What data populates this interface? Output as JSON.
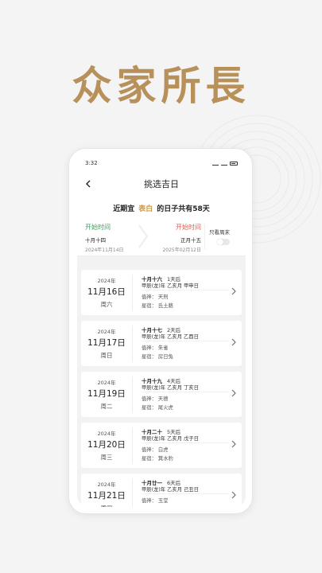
{
  "headline": "众家所長",
  "status": {
    "time": "3:32"
  },
  "nav": {
    "title": "挑选吉日"
  },
  "summary": {
    "prefix": "近期宜",
    "highlight": "表白",
    "suffix": "的日子共有58天"
  },
  "range": {
    "start_label": "开始时间",
    "start_lunar": "十月十四",
    "start_date": "2024年11月14日",
    "end_label": "开始时间",
    "end_lunar": "正月十五",
    "end_date": "2025年02月12日",
    "weekend_label": "只看周末",
    "weekend_only": false
  },
  "days": [
    {
      "year": "2024年",
      "day": "11月16日",
      "weekday": "周六",
      "lunar": "十月十六",
      "after": "1天后",
      "ganzhi": "甲辰(龙)年  乙亥月  甲申日",
      "deity": "值神：  天刑",
      "star": "星宿：  氐土貉"
    },
    {
      "year": "2024年",
      "day": "11月17日",
      "weekday": "周日",
      "lunar": "十月十七",
      "after": "2天后",
      "ganzhi": "甲辰(龙)年  乙亥月  乙酉日",
      "deity": "值神：  朱雀",
      "star": "星宿：  房日兔"
    },
    {
      "year": "2024年",
      "day": "11月19日",
      "weekday": "周二",
      "lunar": "十月十九",
      "after": "4天后",
      "ganzhi": "甲辰(龙)年  乙亥月  丁亥日",
      "deity": "值神：  天德",
      "star": "星宿：  尾火虎"
    },
    {
      "year": "2024年",
      "day": "11月20日",
      "weekday": "周三",
      "lunar": "十月二十",
      "after": "5天后",
      "ganzhi": "甲辰(龙)年  乙亥月  戊子日",
      "deity": "值神：  白虎",
      "star": "星宿：  箕水豹"
    },
    {
      "year": "2024年",
      "day": "11月21日",
      "weekday": "周四",
      "lunar": "十月廿一",
      "after": "6天后",
      "ganzhi": "甲辰(龙)年  乙亥月  己丑日",
      "deity": "值神：  玉堂",
      "star": ""
    }
  ]
}
